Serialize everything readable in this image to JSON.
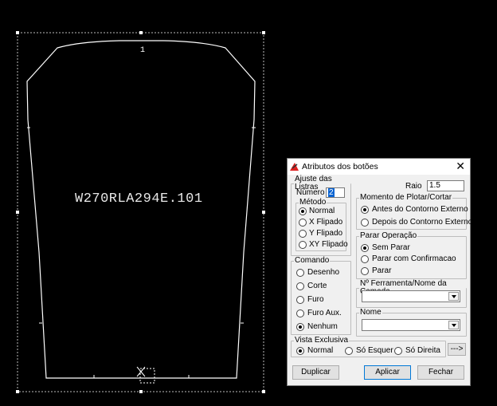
{
  "cad": {
    "part_label": "W270RLA294E.101",
    "tag": "1"
  },
  "dialog": {
    "title": "Atributos dos botões",
    "close_icon": "close-icon",
    "ajuste": {
      "legend": "Ajuste das Listras",
      "numero_label": "Número",
      "numero_value": "2",
      "metodo_legend": "Método",
      "metodo_options": [
        "Normal",
        "X Flipado",
        "Y Flipado",
        "XY Flipado"
      ],
      "metodo_selected": 0
    },
    "raio": {
      "label": "Raio",
      "value": "1.5"
    },
    "momento": {
      "legend": "Momento de Plotar/Cortar",
      "options": [
        "Antes do Contorno Externo",
        "Depois do Contorno Externo"
      ],
      "selected": 0
    },
    "parar": {
      "legend": "Parar Operação",
      "options": [
        "Sem Parar",
        "Parar com Confirmacao",
        "Parar"
      ],
      "selected": 0
    },
    "comando": {
      "legend": "Comando",
      "options": [
        "Desenho",
        "Corte",
        "Furo",
        "Furo Aux.",
        "Nenhum"
      ],
      "selected": 4
    },
    "ferramenta": {
      "legend": "Nº Ferramenta/Nome da Camada",
      "value": ""
    },
    "nome": {
      "legend": "Nome",
      "value": ""
    },
    "vista": {
      "legend": "Vista Exclusiva",
      "options": [
        "Normal",
        "Só Esquer",
        "Só Direita"
      ],
      "selected": 0,
      "more_button": "--->"
    },
    "buttons": {
      "duplicar": "Duplicar",
      "aplicar": "Aplicar",
      "fechar": "Fechar"
    }
  }
}
